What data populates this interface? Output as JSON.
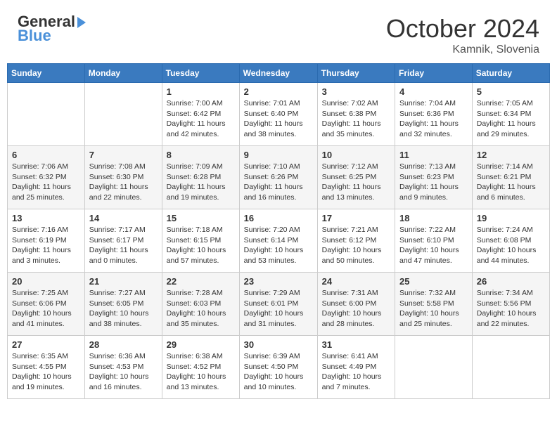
{
  "header": {
    "logo_general": "General",
    "logo_blue": "Blue",
    "month": "October 2024",
    "location": "Kamnik, Slovenia"
  },
  "days_of_week": [
    "Sunday",
    "Monday",
    "Tuesday",
    "Wednesday",
    "Thursday",
    "Friday",
    "Saturday"
  ],
  "weeks": [
    [
      {
        "day": "",
        "info": ""
      },
      {
        "day": "",
        "info": ""
      },
      {
        "day": "1",
        "info": "Sunrise: 7:00 AM\nSunset: 6:42 PM\nDaylight: 11 hours and 42 minutes."
      },
      {
        "day": "2",
        "info": "Sunrise: 7:01 AM\nSunset: 6:40 PM\nDaylight: 11 hours and 38 minutes."
      },
      {
        "day": "3",
        "info": "Sunrise: 7:02 AM\nSunset: 6:38 PM\nDaylight: 11 hours and 35 minutes."
      },
      {
        "day": "4",
        "info": "Sunrise: 7:04 AM\nSunset: 6:36 PM\nDaylight: 11 hours and 32 minutes."
      },
      {
        "day": "5",
        "info": "Sunrise: 7:05 AM\nSunset: 6:34 PM\nDaylight: 11 hours and 29 minutes."
      }
    ],
    [
      {
        "day": "6",
        "info": "Sunrise: 7:06 AM\nSunset: 6:32 PM\nDaylight: 11 hours and 25 minutes."
      },
      {
        "day": "7",
        "info": "Sunrise: 7:08 AM\nSunset: 6:30 PM\nDaylight: 11 hours and 22 minutes."
      },
      {
        "day": "8",
        "info": "Sunrise: 7:09 AM\nSunset: 6:28 PM\nDaylight: 11 hours and 19 minutes."
      },
      {
        "day": "9",
        "info": "Sunrise: 7:10 AM\nSunset: 6:26 PM\nDaylight: 11 hours and 16 minutes."
      },
      {
        "day": "10",
        "info": "Sunrise: 7:12 AM\nSunset: 6:25 PM\nDaylight: 11 hours and 13 minutes."
      },
      {
        "day": "11",
        "info": "Sunrise: 7:13 AM\nSunset: 6:23 PM\nDaylight: 11 hours and 9 minutes."
      },
      {
        "day": "12",
        "info": "Sunrise: 7:14 AM\nSunset: 6:21 PM\nDaylight: 11 hours and 6 minutes."
      }
    ],
    [
      {
        "day": "13",
        "info": "Sunrise: 7:16 AM\nSunset: 6:19 PM\nDaylight: 11 hours and 3 minutes."
      },
      {
        "day": "14",
        "info": "Sunrise: 7:17 AM\nSunset: 6:17 PM\nDaylight: 11 hours and 0 minutes."
      },
      {
        "day": "15",
        "info": "Sunrise: 7:18 AM\nSunset: 6:15 PM\nDaylight: 10 hours and 57 minutes."
      },
      {
        "day": "16",
        "info": "Sunrise: 7:20 AM\nSunset: 6:14 PM\nDaylight: 10 hours and 53 minutes."
      },
      {
        "day": "17",
        "info": "Sunrise: 7:21 AM\nSunset: 6:12 PM\nDaylight: 10 hours and 50 minutes."
      },
      {
        "day": "18",
        "info": "Sunrise: 7:22 AM\nSunset: 6:10 PM\nDaylight: 10 hours and 47 minutes."
      },
      {
        "day": "19",
        "info": "Sunrise: 7:24 AM\nSunset: 6:08 PM\nDaylight: 10 hours and 44 minutes."
      }
    ],
    [
      {
        "day": "20",
        "info": "Sunrise: 7:25 AM\nSunset: 6:06 PM\nDaylight: 10 hours and 41 minutes."
      },
      {
        "day": "21",
        "info": "Sunrise: 7:27 AM\nSunset: 6:05 PM\nDaylight: 10 hours and 38 minutes."
      },
      {
        "day": "22",
        "info": "Sunrise: 7:28 AM\nSunset: 6:03 PM\nDaylight: 10 hours and 35 minutes."
      },
      {
        "day": "23",
        "info": "Sunrise: 7:29 AM\nSunset: 6:01 PM\nDaylight: 10 hours and 31 minutes."
      },
      {
        "day": "24",
        "info": "Sunrise: 7:31 AM\nSunset: 6:00 PM\nDaylight: 10 hours and 28 minutes."
      },
      {
        "day": "25",
        "info": "Sunrise: 7:32 AM\nSunset: 5:58 PM\nDaylight: 10 hours and 25 minutes."
      },
      {
        "day": "26",
        "info": "Sunrise: 7:34 AM\nSunset: 5:56 PM\nDaylight: 10 hours and 22 minutes."
      }
    ],
    [
      {
        "day": "27",
        "info": "Sunrise: 6:35 AM\nSunset: 4:55 PM\nDaylight: 10 hours and 19 minutes."
      },
      {
        "day": "28",
        "info": "Sunrise: 6:36 AM\nSunset: 4:53 PM\nDaylight: 10 hours and 16 minutes."
      },
      {
        "day": "29",
        "info": "Sunrise: 6:38 AM\nSunset: 4:52 PM\nDaylight: 10 hours and 13 minutes."
      },
      {
        "day": "30",
        "info": "Sunrise: 6:39 AM\nSunset: 4:50 PM\nDaylight: 10 hours and 10 minutes."
      },
      {
        "day": "31",
        "info": "Sunrise: 6:41 AM\nSunset: 4:49 PM\nDaylight: 10 hours and 7 minutes."
      },
      {
        "day": "",
        "info": ""
      },
      {
        "day": "",
        "info": ""
      }
    ]
  ]
}
